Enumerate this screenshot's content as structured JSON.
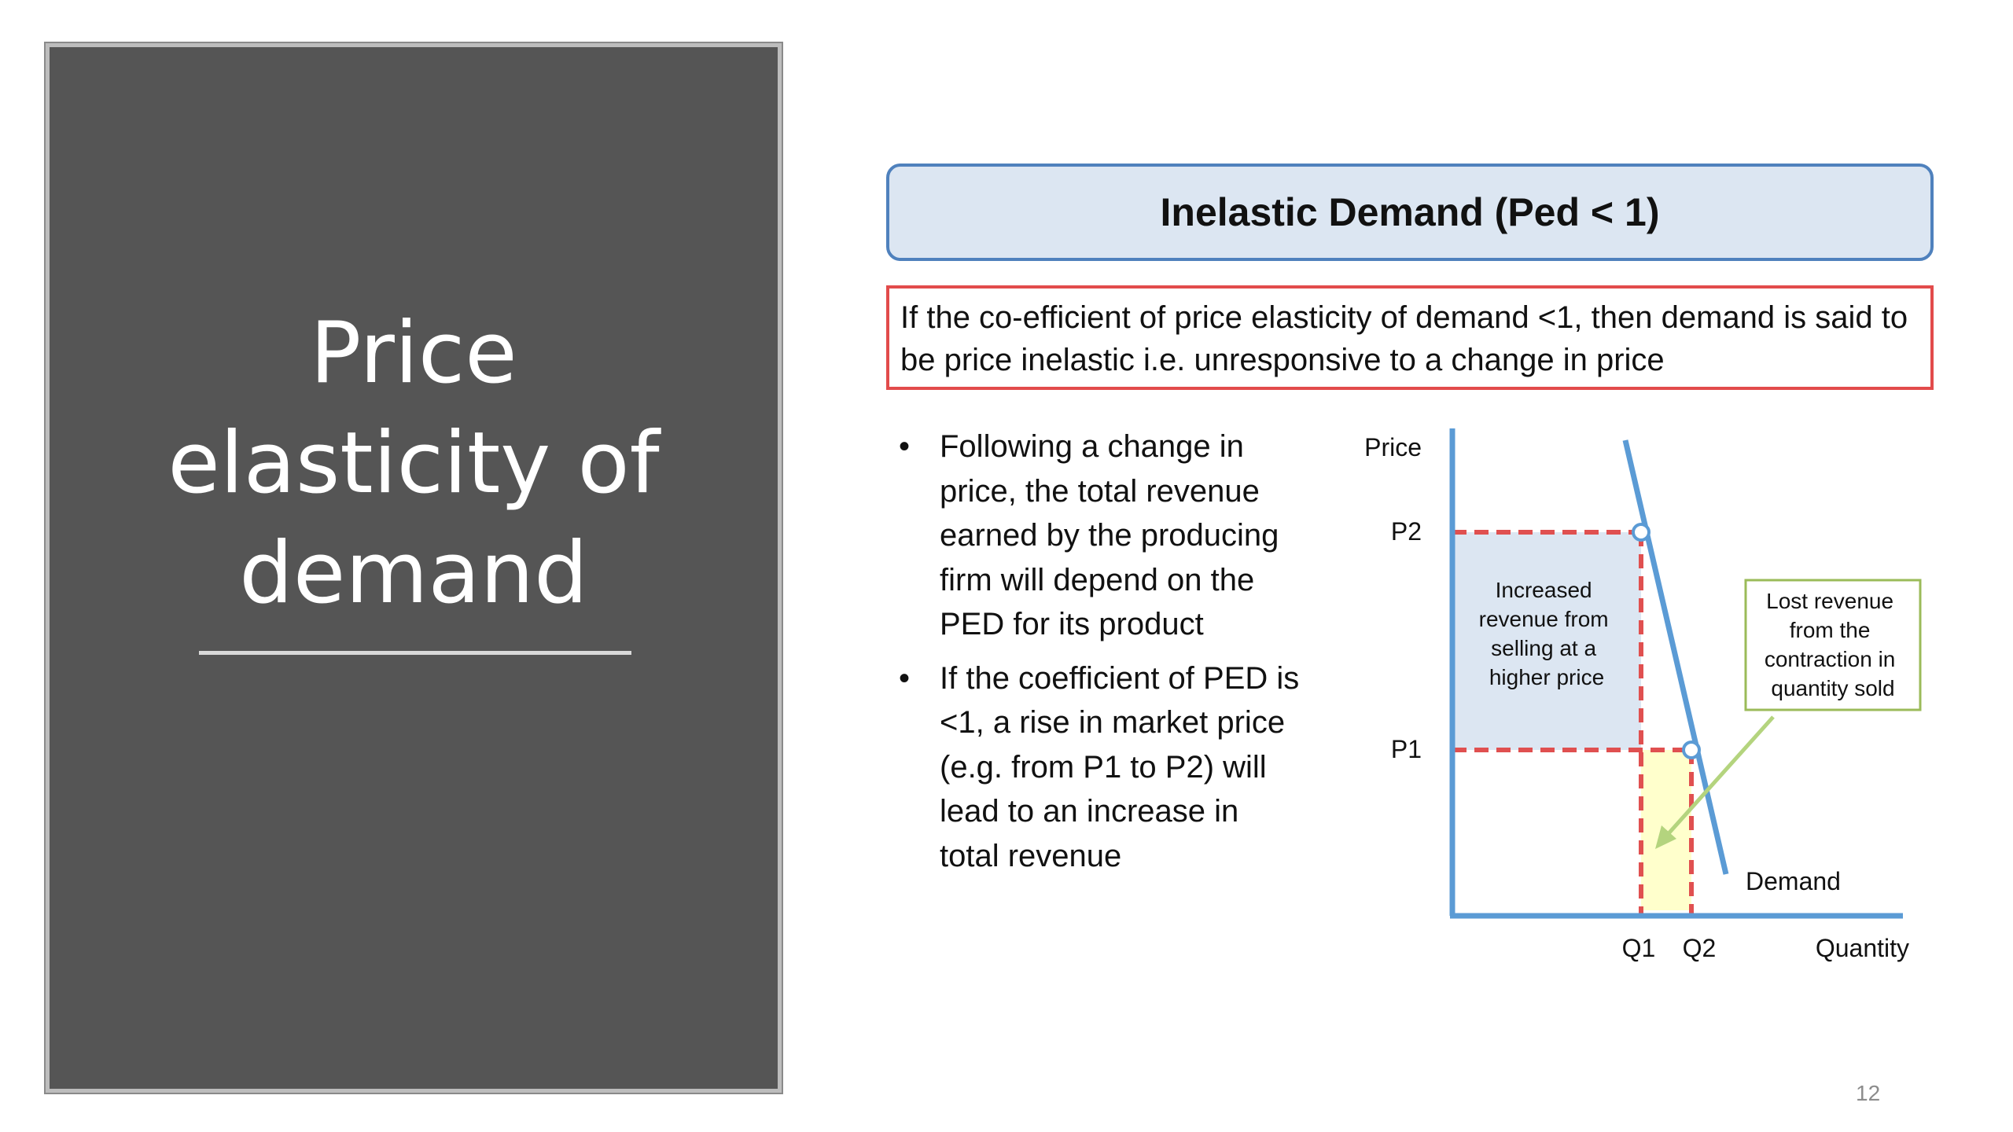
{
  "left_panel": {
    "title_lines": [
      "Price",
      "elasticity of",
      "demand"
    ]
  },
  "header": {
    "title": "Inelastic Demand (Ped < 1)"
  },
  "definition": {
    "text": "If the co-efficient of price elasticity of demand <1, then demand is said to be price inelastic i.e. unresponsive to a change in price"
  },
  "bullets": [
    {
      "marker": "•",
      "lines": [
        "Following a change in",
        "price, the total revenue",
        "earned by the producing",
        "firm will depend on the",
        "PED for its product"
      ]
    },
    {
      "marker": "•",
      "lines": [
        "If the coefficient of PED is",
        "<1, a rise in market price",
        "(e.g. from P1 to P2) will",
        "lead to an increase in",
        "total revenue"
      ]
    }
  ],
  "diagram": {
    "y_axis_label": "Price",
    "x_axis_label": "Quantity",
    "p2_label": "P2",
    "p1_label": "P1",
    "q1_label": "Q1",
    "q2_label": "Q2",
    "curve_label": "Demand",
    "gain_area_lines": [
      "Increased",
      "revenue from",
      "selling at a",
      "higher price"
    ],
    "loss_note_lines": [
      "Lost revenue",
      "from the",
      "contraction in",
      "quantity sold"
    ],
    "colors": {
      "axis": "#5b9bd5",
      "curve": "#5b9bd5",
      "dashed": "#e05050",
      "gain_fill": "#dce6f2",
      "loss_fill": "#ffffcc",
      "note_border": "#9bbb59",
      "arrow": "#b4d47e"
    }
  },
  "page_number": "12"
}
